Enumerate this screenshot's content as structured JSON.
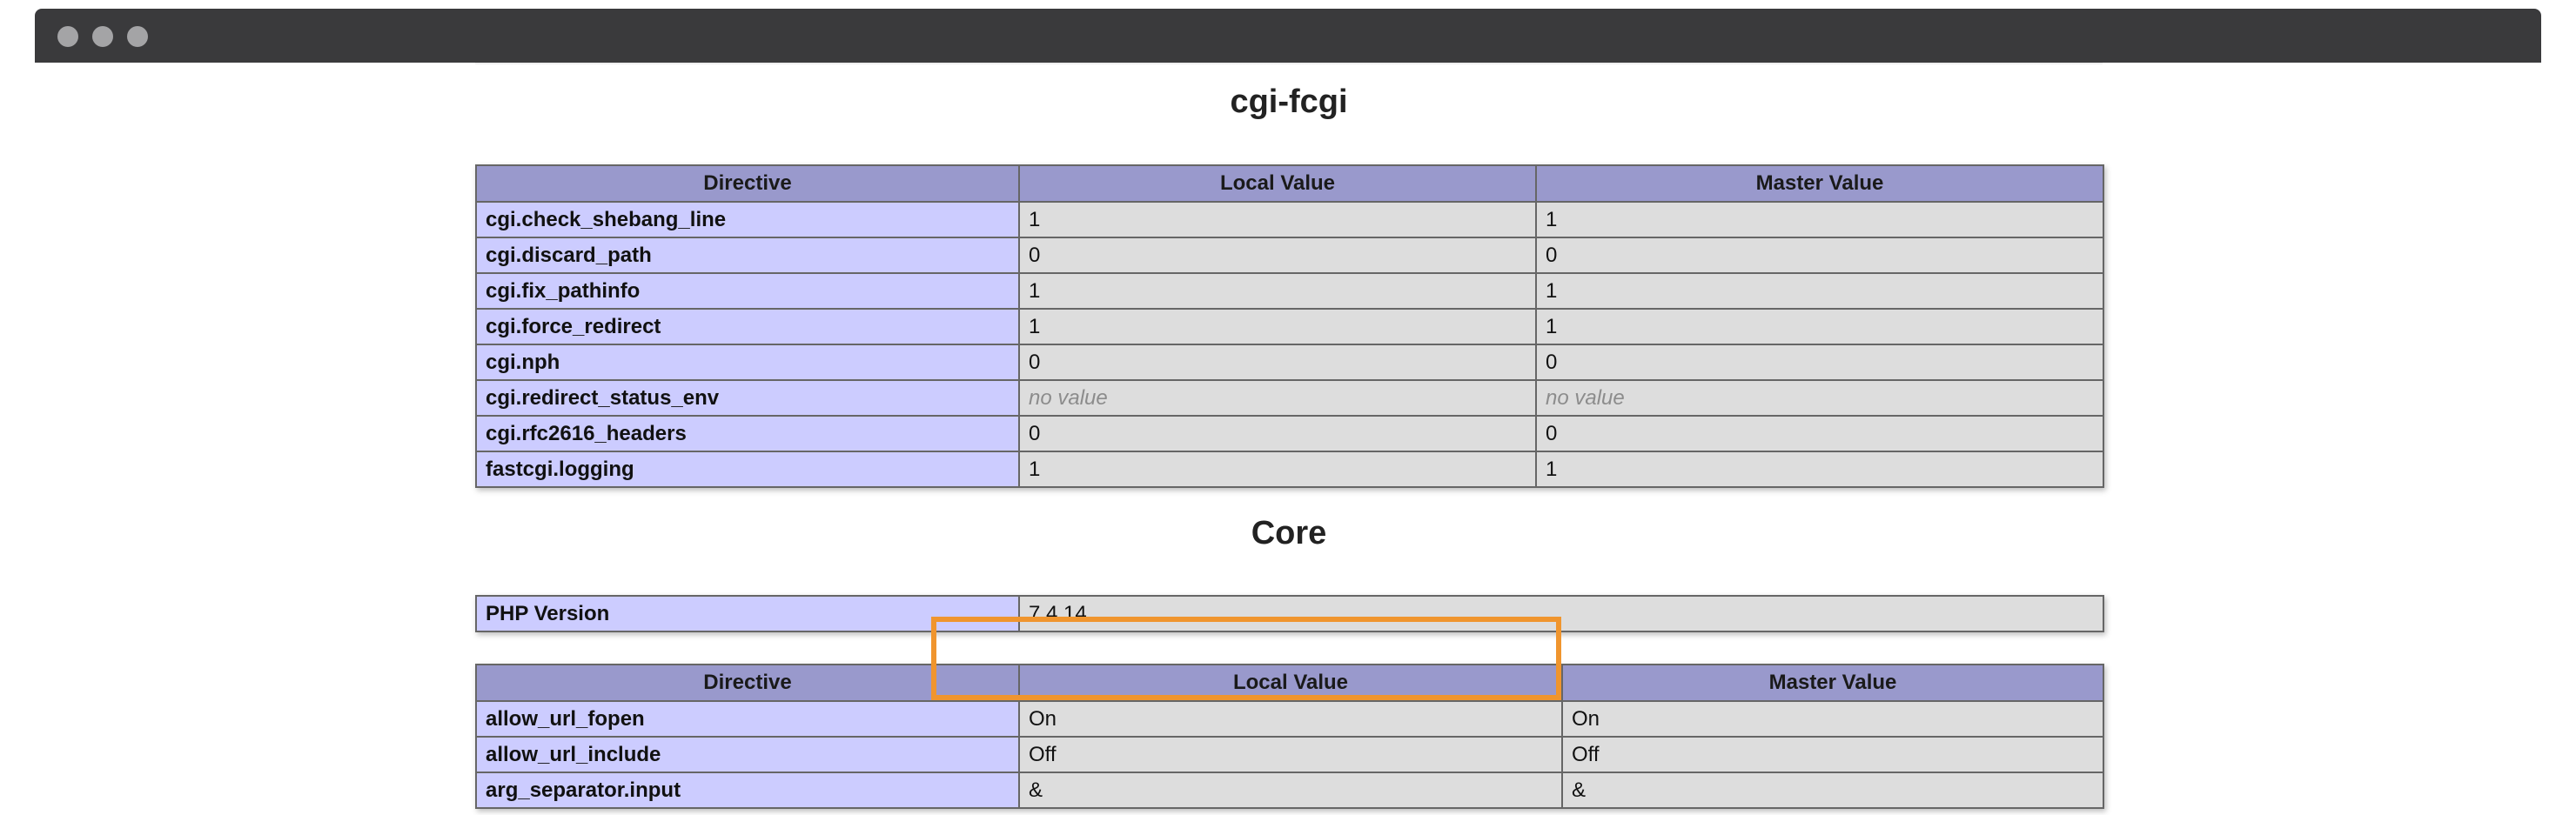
{
  "window": {
    "controls": [
      "close-dot",
      "minimize-dot",
      "maximize-dot"
    ]
  },
  "sections": [
    {
      "title": "cgi-fcgi",
      "headers": [
        "Directive",
        "Local Value",
        "Master Value"
      ],
      "rows": [
        {
          "directive": "cgi.check_shebang_line",
          "local": "1",
          "master": "1"
        },
        {
          "directive": "cgi.discard_path",
          "local": "0",
          "master": "0"
        },
        {
          "directive": "cgi.fix_pathinfo",
          "local": "1",
          "master": "1"
        },
        {
          "directive": "cgi.force_redirect",
          "local": "1",
          "master": "1"
        },
        {
          "directive": "cgi.nph",
          "local": "0",
          "master": "0"
        },
        {
          "directive": "cgi.redirect_status_env",
          "local": "no value",
          "master": "no value"
        },
        {
          "directive": "cgi.rfc2616_headers",
          "local": "0",
          "master": "0"
        },
        {
          "directive": "fastcgi.logging",
          "local": "1",
          "master": "1"
        }
      ]
    },
    {
      "title": "Core",
      "info": {
        "label": "PHP Version",
        "value": "7.4.14"
      },
      "headers": [
        "Directive",
        "Local Value",
        "Master Value"
      ],
      "rows": [
        {
          "directive": "allow_url_fopen",
          "local": "On",
          "master": "On"
        },
        {
          "directive": "allow_url_include",
          "local": "Off",
          "master": "Off"
        },
        {
          "directive": "arg_separator.input",
          "local": "&",
          "master": "&"
        }
      ]
    }
  ],
  "highlight_color": "#f0952e",
  "colors": {
    "header_bg": "#9999cc",
    "directive_bg": "#ccccff",
    "value_bg": "#dddddd",
    "titlebar": "#3a3a3c"
  }
}
